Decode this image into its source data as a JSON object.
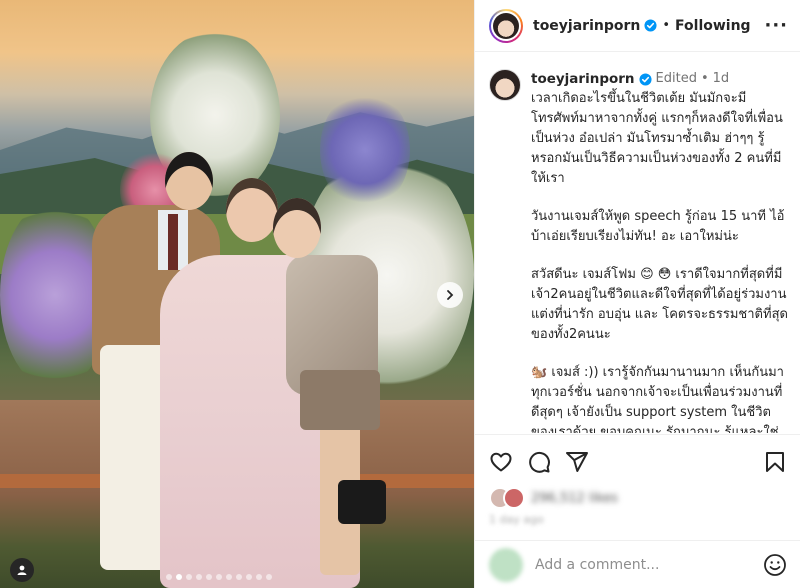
{
  "post": {
    "username": "toeyjarinporn",
    "separator": "•",
    "follow_label": "Following",
    "more_label": "···",
    "edited_label": "Edited",
    "time_label": "1d"
  },
  "caption": {
    "paragraphs": [
      "เวลาเกิดอะไรขึ้นในชีวิตเต้ย มันมักจะมีโทรศัพท์มาหาจากทั้งคู่ แรกๆก็หลงดีใจที่เพื่อนเป็นห่วง อ๋อเปล่า มันโทรมาซ้ำเติม ฮ่าๆๆ รู้หรอกมันเป็นวิธีความเป็นห่วงของทั้ง 2 คนที่มีให้เรา",
      "วันงานเจมส์ให้พูด speech รู้ก่อน 15 นาที ไอ้บ้าเอ่ยเรียบเรียงไม่ทัน! อะ เอาใหม่น่ะ",
      "สวัสดีนะ เจมส์โฟม 😊 😳  เราดีใจมากที่สุดที่มีเจ้า2คนอยู่ในชีวิตและดีใจที่สุดที่ได้อยู่ร่วมงานแต่งที่น่ารัก อบอุ่น และ โคตรจะธรรมชาติที่สุดของทั้ง2คนนะ",
      "🐿️ เจมส์ :)) เรารู้จักกันมานานมาก เห็นกันมาทุกเวอร์ชั่น นอกจากเจ้าจะเป็นเพื่อนร่วมงานที่ดีสุดๆ เจ้ายังเป็น support system ในชีวิตของเราด้วย ขอบคุณนะ รักมากนะ รู้แหละใช่มะ เราว่าเวอร์ชั่นนี้ของเจมส์ แม่ง โคตรเหมาะกับเจมส์ที่สุด เจมส์อย่างนี้ใช่เลย"
    ]
  },
  "likes": {
    "text": "296,512 likes"
  },
  "date": {
    "text": "1 day ago"
  },
  "comment": {
    "placeholder": "Add a comment..."
  },
  "carousel": {
    "count": 11,
    "active_index": 1
  },
  "colors": {
    "verified": "#0095f6",
    "text": "#262626",
    "muted": "#737373"
  },
  "icons": [
    "verified-badge-icon",
    "heart-icon",
    "comment-icon",
    "share-icon",
    "bookmark-icon",
    "chevron-right-icon",
    "user-tag-icon",
    "emoji-icon"
  ]
}
